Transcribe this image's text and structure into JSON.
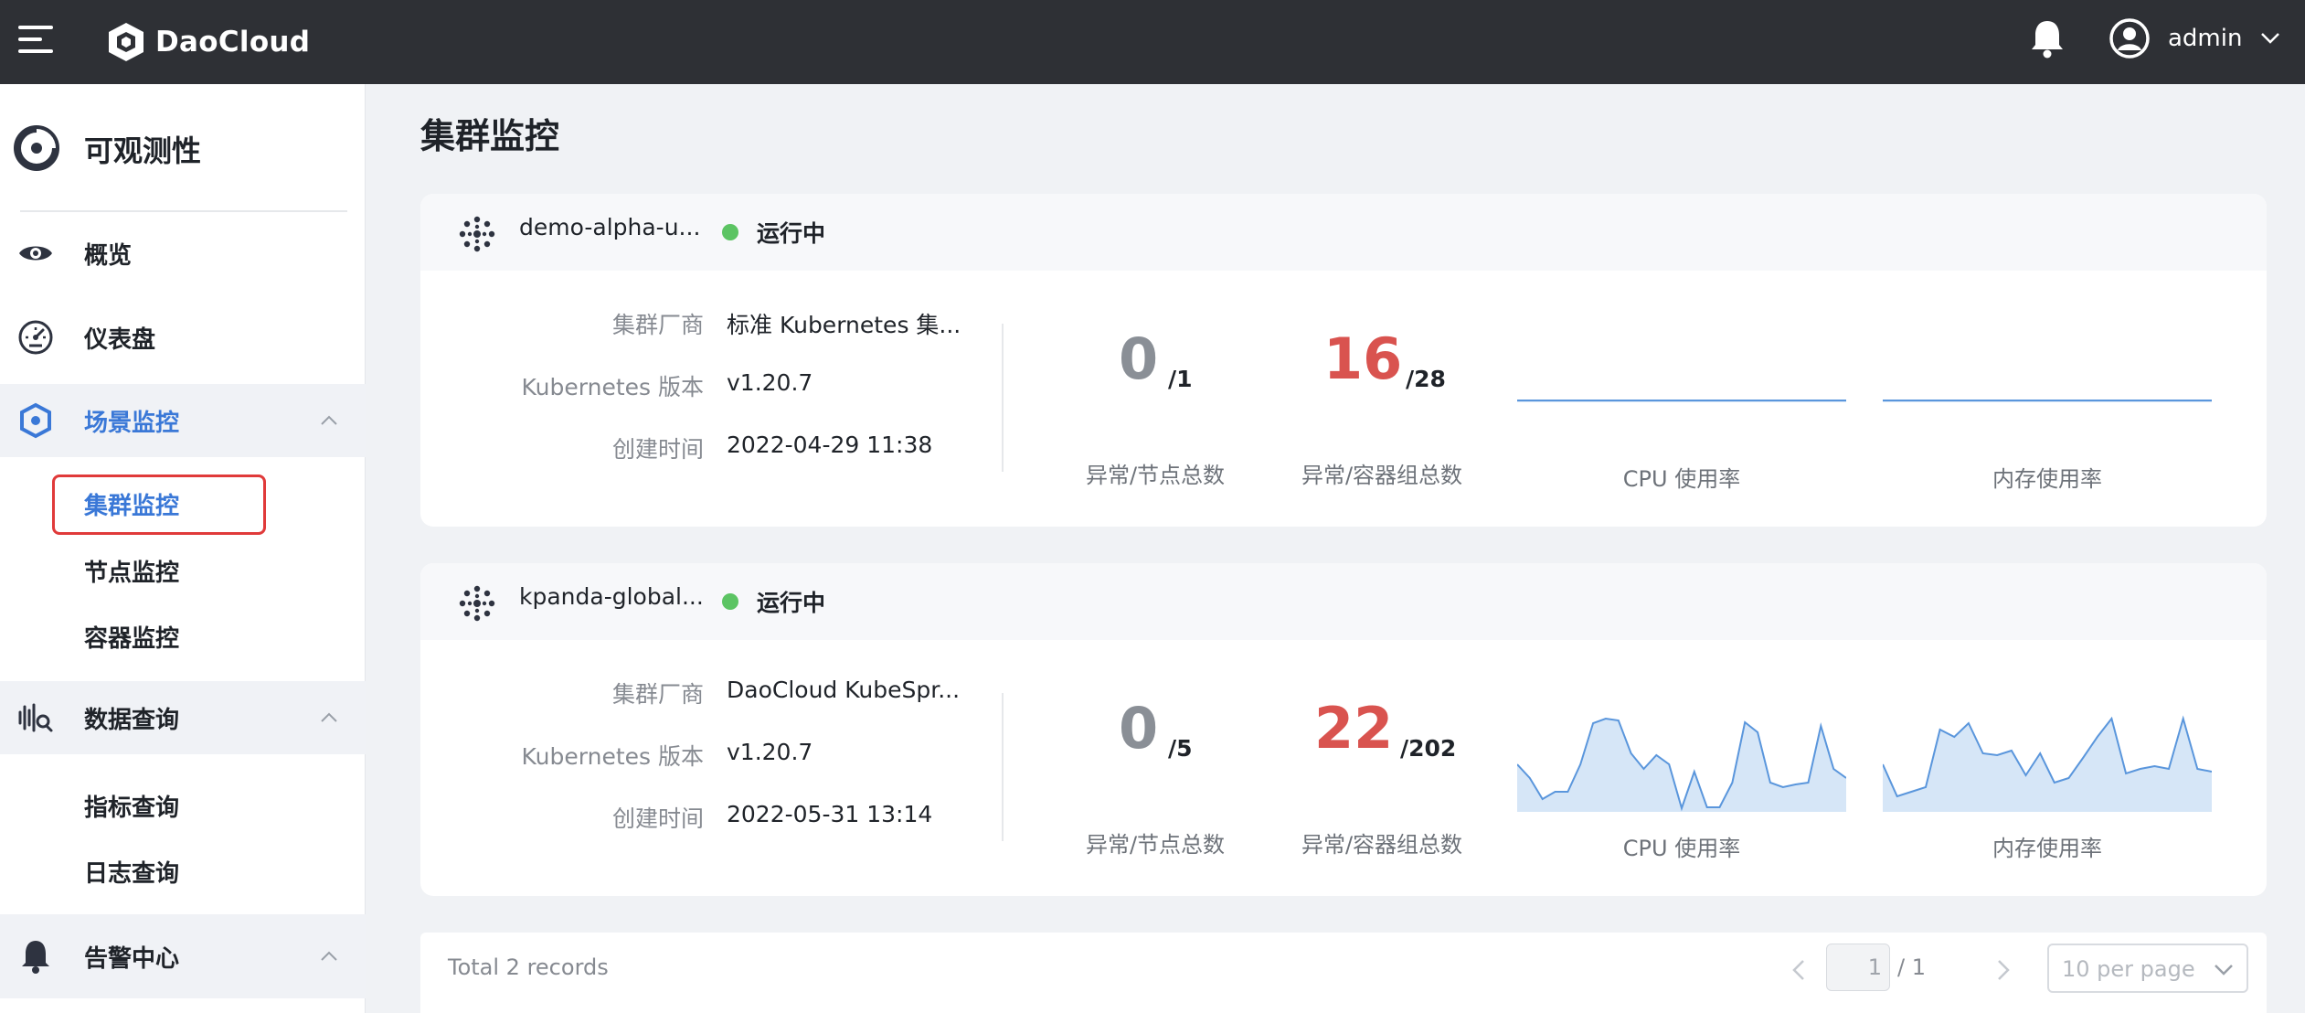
{
  "header": {
    "brand": "DaoCloud",
    "user": "admin"
  },
  "sidebar": {
    "title": "可观测性",
    "items": [
      {
        "label": "概览"
      },
      {
        "label": "仪表盘"
      },
      {
        "label": "场景监控",
        "sub": [
          "集群监控",
          "节点监控",
          "容器监控"
        ]
      },
      {
        "label": "数据查询",
        "sub": [
          "指标查询",
          "日志查询"
        ]
      },
      {
        "label": "告警中心"
      }
    ]
  },
  "page": {
    "title": "集群监控"
  },
  "labels": {
    "vendor": "集群厂商",
    "k8s_version": "Kubernetes 版本",
    "created": "创建时间",
    "node_cap": "异常/节点总数",
    "pod_cap": "异常/容器组总数",
    "cpu_cap": "CPU 使用率",
    "mem_cap": "内存使用率"
  },
  "clusters": [
    {
      "name": "demo-alpha-u...",
      "status": "运行中",
      "vendor": "标准 Kubernetes 集...",
      "version": "v1.20.7",
      "created": "2022-04-29 11:38",
      "node_abnormal": "0",
      "node_total": "/1",
      "pod_abnormal": "16",
      "pod_total": "/28",
      "cpu_series": [
        0,
        0,
        0,
        0,
        0,
        0,
        0,
        0,
        0,
        0,
        0,
        0,
        0,
        0,
        0,
        0,
        0,
        0,
        0,
        0,
        0,
        0,
        0,
        0,
        0,
        0,
        0,
        0,
        0,
        0,
        0,
        0,
        0,
        0,
        0,
        0,
        0,
        0,
        0,
        0
      ],
      "mem_series": [
        0,
        0,
        0,
        0,
        0,
        0,
        0,
        0,
        0,
        0,
        0,
        0,
        0,
        0,
        0,
        0,
        0,
        0,
        0,
        0,
        0,
        0,
        0,
        0,
        0,
        0,
        0,
        0,
        0,
        0,
        0,
        0,
        0,
        0,
        0,
        0,
        0,
        0,
        0,
        0
      ]
    },
    {
      "name": "kpanda-global...",
      "status": "运行中",
      "vendor": "DaoCloud KubeSpr...",
      "version": "v1.20.7",
      "created": "2022-05-31 13:14",
      "node_abnormal": "0",
      "node_total": "/5",
      "pod_abnormal": "22",
      "pod_total": "/202",
      "cpu_series": [
        0.5,
        0.35,
        0.12,
        0.2,
        0.2,
        0.5,
        0.95,
        1.0,
        0.98,
        0.62,
        0.45,
        0.6,
        0.5,
        0.02,
        0.42,
        0.03,
        0.03,
        0.3,
        0.96,
        0.85,
        0.3,
        0.25,
        0.28,
        0.3,
        0.92,
        0.45,
        0.35
      ],
      "mem_series": [
        0.5,
        0.15,
        0.2,
        0.25,
        0.88,
        0.8,
        0.95,
        0.62,
        0.6,
        0.65,
        0.38,
        0.62,
        0.3,
        0.35,
        0.57,
        0.8,
        1.0,
        0.4,
        0.45,
        0.48,
        0.45,
        1.0,
        0.45,
        0.42
      ]
    }
  ],
  "pagination": {
    "total": "Total 2 records",
    "page": "1",
    "pages": "/ 1",
    "page_size": "10 per page"
  },
  "colors": {
    "accent": "#3a78d7",
    "running": "#5cc463",
    "abnormal": "#d9534f",
    "spark_line": "#5a96dc",
    "spark_fill": "#d6e6f7"
  }
}
